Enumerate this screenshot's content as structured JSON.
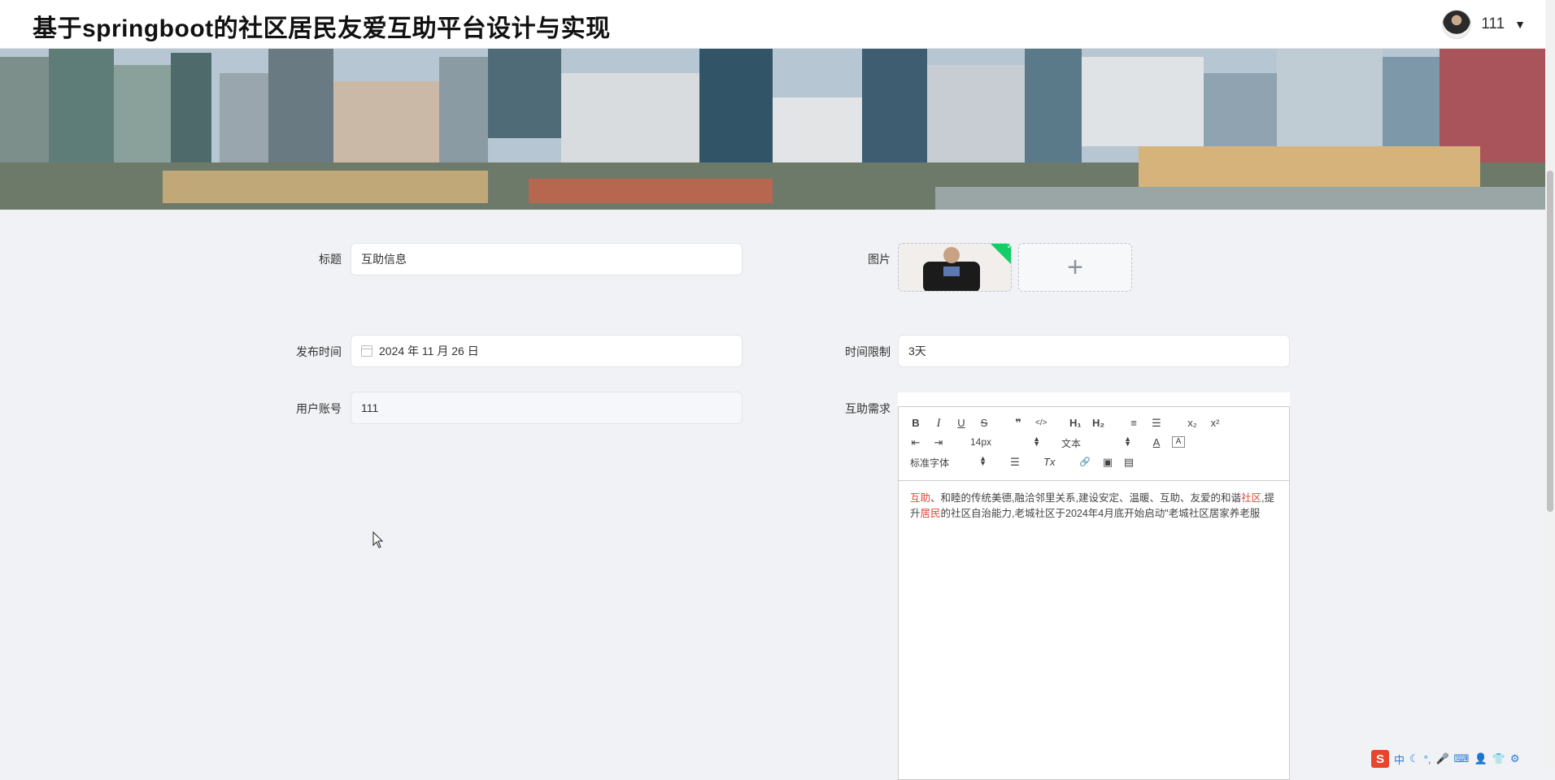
{
  "header": {
    "title": "基于springboot的社区居民友爱互助平台设计与实现",
    "user": {
      "name": "111",
      "caret": "▼"
    }
  },
  "form": {
    "title": {
      "label": "标题",
      "value": "互助信息"
    },
    "image": {
      "label": "图片",
      "add_symbol": "+"
    },
    "publish_time": {
      "label": "发布时间",
      "value": "2024 年 11 月 26 日"
    },
    "time_limit": {
      "label": "时间限制",
      "value": "3天"
    },
    "user_account": {
      "label": "用户账号",
      "value": "111"
    },
    "need": {
      "label": "互助需求"
    }
  },
  "editor": {
    "toolbar": {
      "bold": "B",
      "italic": "I",
      "underline": "U",
      "strike": "S",
      "quote": "❞",
      "code": "</>",
      "h1": "H₁",
      "h2": "H₂",
      "ordered": "≡",
      "bullet": "☰",
      "sub": "x₂",
      "sup": "x²",
      "outdent": "⇤",
      "indent": "⇥",
      "size": "14px",
      "header": "文本",
      "font": "标准字体",
      "align": "☰",
      "color": "A",
      "bg": "A",
      "clean": "Tx",
      "link": "🔗",
      "image": "▣",
      "video": "▤"
    },
    "content": {
      "seg1": "互助",
      "seg2": "、和睦的传统美德,融洽邻里关系,建设安定、温暖、互助、友爱的和谐",
      "seg3": "社区",
      "seg4": ",提升",
      "seg5": "居民",
      "seg6": "的社区自治能力,老城社区于2024年4月底开始启动\"老城社区居家养老服",
      "seg7": ""
    }
  },
  "tray": {
    "logo": "S",
    "items": [
      "中",
      "☾",
      "°,",
      "🎤",
      "⌨",
      "👤",
      "👕",
      "⚙"
    ]
  },
  "colors": {
    "accent": "#409eff",
    "highlight": "#e0453b",
    "success": "#13ce66"
  }
}
